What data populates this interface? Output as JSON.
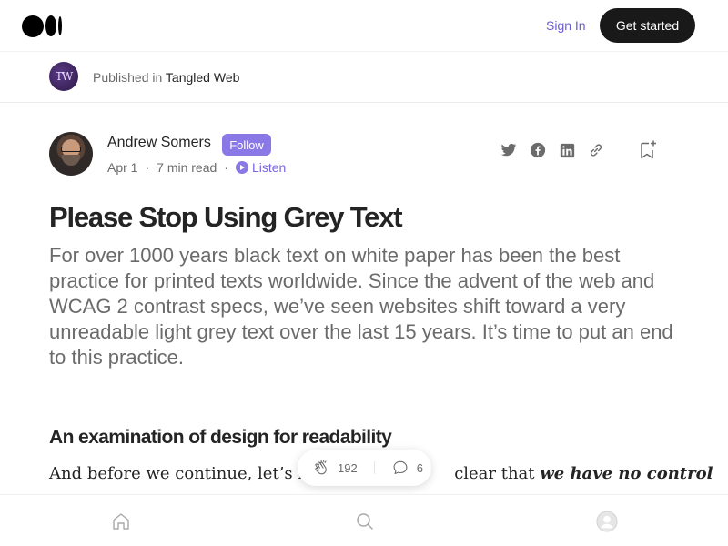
{
  "header": {
    "logo": "medium-logo",
    "sign_in": "Sign In",
    "get_started": "Get started"
  },
  "publication": {
    "prefix": "Published in",
    "name": "Tangled Web",
    "logo_text": "TW"
  },
  "author": {
    "name": "Andrew Somers",
    "follow_label": "Follow",
    "date": "Apr 1",
    "read_time": "7 min read",
    "separator": "·",
    "listen_label": "Listen"
  },
  "share_icons": [
    "twitter-icon",
    "facebook-icon",
    "linkedin-icon",
    "link-icon"
  ],
  "article": {
    "title": "Please Stop Using Grey Text",
    "subtitle": "For over 1000 years black text on white paper has been the best practice for printed texts worldwide. Since the advent of the web and WCAG 2 contrast specs, we’ve seen websites shift toward a very unreadable light grey text over the last 15 years. It’s time to put an end to this practice.",
    "heading": "An examination of design for readability",
    "para_start": "And before we continue, let’s ma",
    "para_mid": "clear that ",
    "para_emph": "we have no control"
  },
  "engagement": {
    "claps": "192",
    "responses": "6"
  },
  "colors": {
    "accent": "#6b5bd6",
    "follow_bg": "#8a78e6",
    "dark_button": "#191919",
    "text": "#242424",
    "muted": "#6b6b6b"
  }
}
